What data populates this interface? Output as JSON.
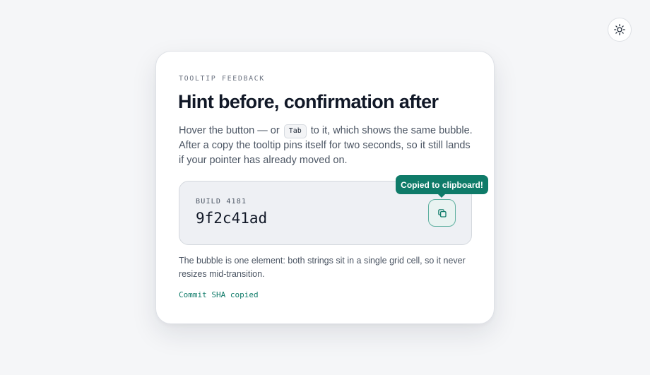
{
  "theme_toggle": {
    "icon": "sun-icon"
  },
  "card": {
    "eyebrow": "TOOLTIP FEEDBACK",
    "title": "Hint before, confirmation after",
    "intro": {
      "before_key": "Hover the button — or ",
      "key": "Tab",
      "after_key": " to it, which shows the same bubble. After a copy the tooltip pins itself for two seconds, so it still lands if your pointer has already moved on."
    },
    "build": {
      "label": "BUILD 4181",
      "hash": "9f2c41ad",
      "copy_icon": "copy-icon",
      "tooltip": "Copied to clipboard!"
    },
    "note": "The bubble is one element: both strings sit in a single grid cell, so it never resizes mid-transition.",
    "status": "Commit SHA copied"
  },
  "colors": {
    "accent": "#0f7b69",
    "page_background": "#f5f6f8",
    "card_background": "#ffffff",
    "panel_background": "#eef0f4",
    "heading_text": "#111827",
    "body_text": "#4b5563"
  }
}
